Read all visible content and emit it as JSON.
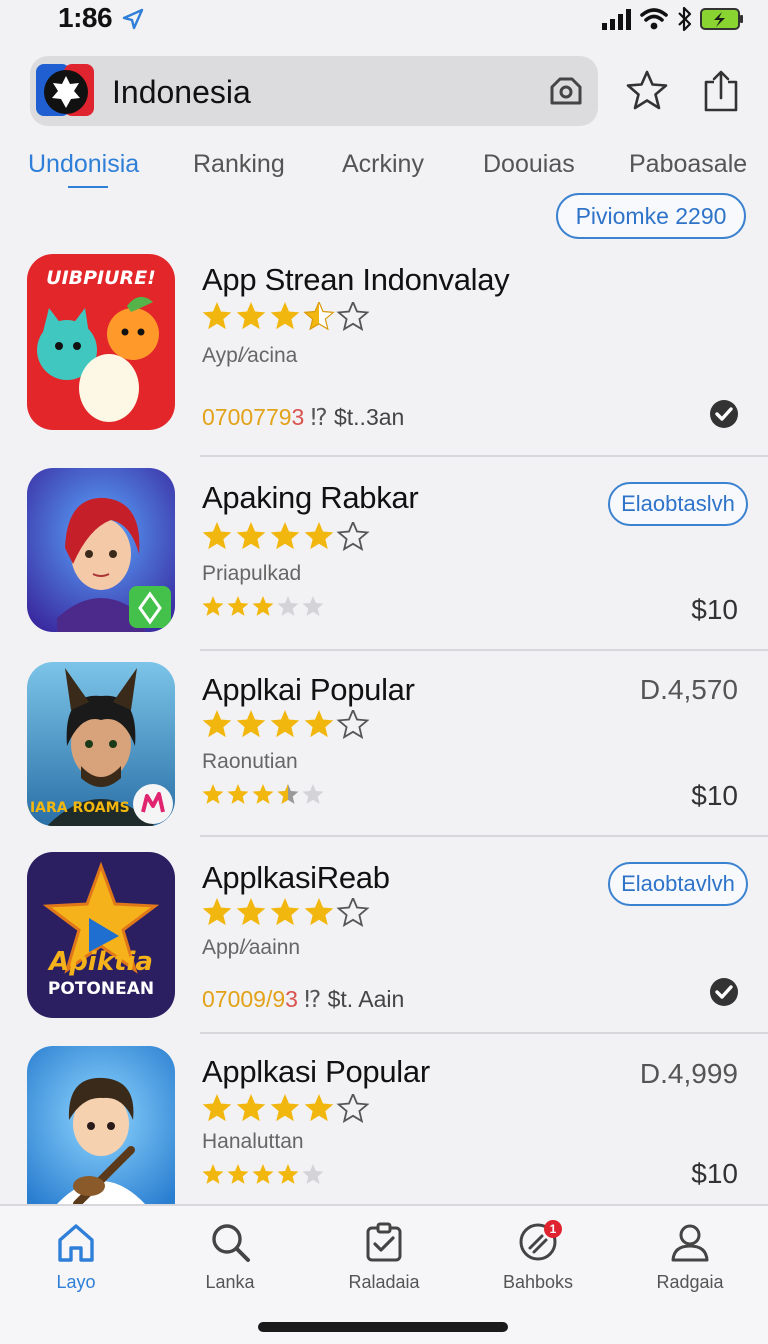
{
  "status": {
    "time": "1:86"
  },
  "search": {
    "query": "Indonesia"
  },
  "tabs": [
    {
      "label": "Undonisia",
      "active": true
    },
    {
      "label": "Ranking",
      "active": false
    },
    {
      "label": "Acrkiny",
      "active": false
    },
    {
      "label": "Doouias",
      "active": false
    },
    {
      "label": "Paboasale",
      "active": false
    }
  ],
  "promo": {
    "label": "Piviomke 2290"
  },
  "apps": [
    {
      "name": "App Strean Indonvalay",
      "rating": 3.5,
      "subtitle": "Ayp/⁄acina",
      "meta_code": "0700779",
      "meta_code_red": "3",
      "meta_sep": "⁉",
      "meta_downloads": "$t..3an",
      "icon_text": "UIBPIURE!"
    },
    {
      "name": "Apaking Rabkar",
      "rating": 4,
      "subtitle": "Priapulkad",
      "mini_rating": 3,
      "action_label": "Elaobtaslvh",
      "price": "$10"
    },
    {
      "name": "Applkai Popular",
      "rating": 4,
      "subtitle": "Raonutian",
      "mini_rating": 3.5,
      "top_price": "D.4,570",
      "price": "$10",
      "icon_text": "RAIARA ROAMS"
    },
    {
      "name": "ApplkasiReab",
      "rating": 4,
      "subtitle": "App/⁄aainn",
      "meta_code": "07009/9",
      "meta_code_red": "3",
      "meta_sep": "⁉",
      "meta_downloads": "$t. Aain",
      "action_label": "Elaobtavlvh",
      "icon_text_1": "Apiktia",
      "icon_text_2": "POTONEAN"
    },
    {
      "name": "Applkasi Popular",
      "rating": 4,
      "subtitle": "Hanaluttan",
      "mini_rating": 4,
      "top_price": "D.4,999",
      "price": "$10"
    }
  ],
  "tab_bar": [
    {
      "label": "Layo",
      "icon": "home-icon",
      "active": true
    },
    {
      "label": "Lanka",
      "icon": "search-icon",
      "active": false
    },
    {
      "label": "Raladaia",
      "icon": "checklist-icon",
      "active": false
    },
    {
      "label": "Bahboks",
      "icon": "tag-icon",
      "active": false,
      "badge": "1"
    },
    {
      "label": "Radgaia",
      "icon": "person-icon",
      "active": false
    }
  ],
  "colors": {
    "accent": "#2f7fd8",
    "star": "#f2b70f",
    "background": "#f2f2f4",
    "badge": "#e0242f"
  }
}
